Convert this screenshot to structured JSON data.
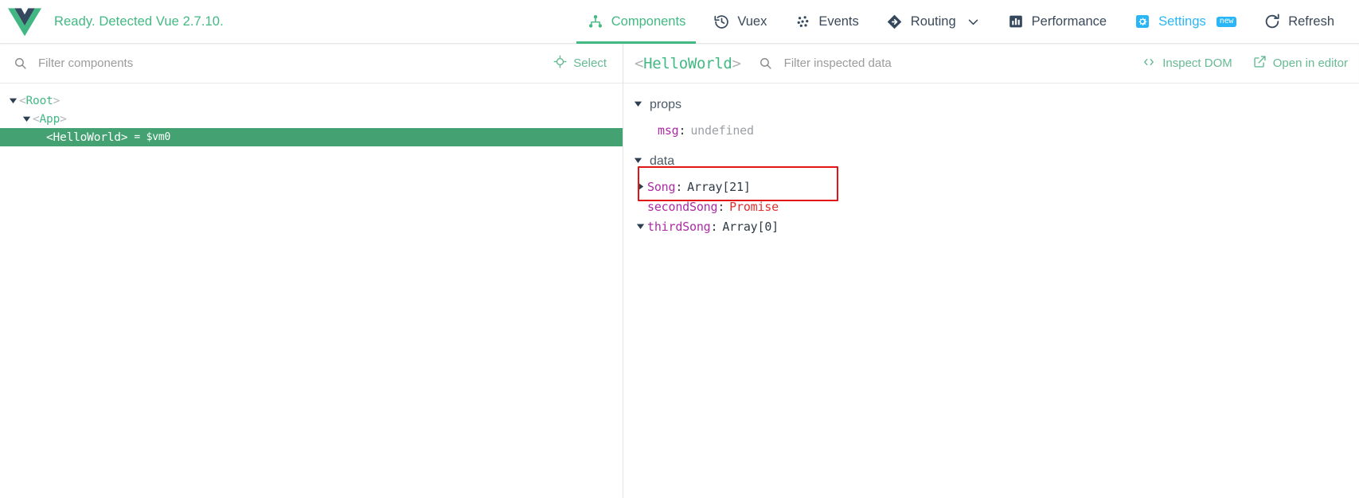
{
  "header": {
    "logo_icon": "vue-logo",
    "status_text": "Ready. Detected Vue 2.7.10.",
    "tabs": [
      {
        "label": "Components",
        "icon": "components-tree-icon",
        "active": true
      },
      {
        "label": "Vuex",
        "icon": "history-clock-icon",
        "active": false
      },
      {
        "label": "Events",
        "icon": "events-dots-icon",
        "active": false
      },
      {
        "label": "Routing",
        "icon": "routing-arrow-icon",
        "active": false,
        "has_dropdown": true
      },
      {
        "label": "Performance",
        "icon": "bar-chart-icon",
        "active": false
      },
      {
        "label": "Settings",
        "icon": "gear-icon",
        "active": false,
        "badge": "new"
      },
      {
        "label": "Refresh",
        "icon": "refresh-icon",
        "active": false
      }
    ]
  },
  "left_pane": {
    "search_icon": "search-icon",
    "filter_placeholder": "Filter components",
    "filter_value": "",
    "select_button": {
      "label": "Select",
      "icon": "target-crosshair-icon"
    },
    "tree": [
      {
        "name": "Root",
        "depth": 0,
        "expanded": true,
        "selected": false,
        "vm": ""
      },
      {
        "name": "App",
        "depth": 1,
        "expanded": true,
        "selected": false,
        "vm": ""
      },
      {
        "name": "HelloWorld",
        "depth": 2,
        "expanded": false,
        "selected": true,
        "vm": "= $vm0"
      }
    ]
  },
  "right_pane": {
    "inspected_component": "HelloWorld",
    "search_icon": "search-icon",
    "filter_placeholder": "Filter inspected data",
    "filter_value": "",
    "actions": [
      {
        "label": "Inspect DOM",
        "icon": "code-brackets-icon"
      },
      {
        "label": "Open in editor",
        "icon": "external-link-icon"
      }
    ],
    "groups": [
      {
        "title": "props",
        "expanded": true,
        "rows": [
          {
            "key": "msg",
            "value": "undefined",
            "value_type": "gray",
            "caret": "none",
            "indent": true
          }
        ]
      },
      {
        "title": "data",
        "expanded": true,
        "rows": [
          {
            "key": "Song",
            "value": "Array[21]",
            "value_type": "dark",
            "caret": "collapsed",
            "indent": false
          },
          {
            "key": "secondSong",
            "value": "Promise",
            "value_type": "red",
            "caret": "none",
            "indent": true
          },
          {
            "key": "thirdSong",
            "value": "Array[0]",
            "value_type": "dark",
            "caret": "expanded",
            "indent": false
          }
        ]
      }
    ],
    "annotation": {
      "type": "red-rectangle",
      "covers": "Song and secondSong rows"
    }
  },
  "colors": {
    "vue_green": "#42b983",
    "selection_green": "#44a171",
    "settings_blue": "#29b6f6",
    "annotation_red": "#e11515",
    "key_magenta": "#ad2ba5",
    "value_red": "#e03030",
    "text_dark": "#3a4a5a"
  }
}
